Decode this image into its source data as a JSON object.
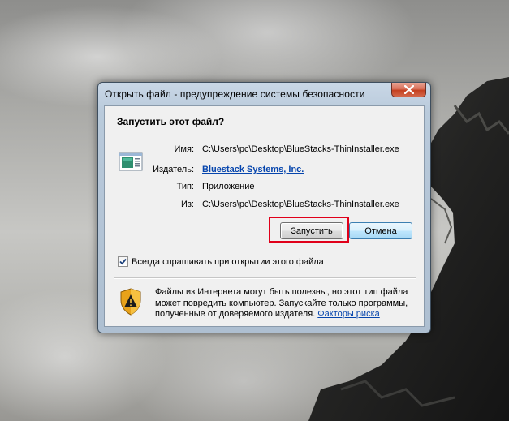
{
  "dialog": {
    "title": "Открыть файл - предупреждение системы безопасности",
    "heading": "Запустить этот файл?",
    "fields": {
      "name_label": "Имя:",
      "name_value": "C:\\Users\\pc\\Desktop\\BlueStacks-ThinInstaller.exe",
      "publisher_label": "Издатель:",
      "publisher_value": "Bluestack Systems, Inc.",
      "type_label": "Тип:",
      "type_value": "Приложение",
      "from_label": "Из:",
      "from_value": "C:\\Users\\pc\\Desktop\\BlueStacks-ThinInstaller.exe"
    },
    "buttons": {
      "run": "Запустить",
      "cancel": "Отмена"
    },
    "checkbox": {
      "label": "Всегда спрашивать при открытии этого файла",
      "checked": true
    },
    "warning": {
      "text": "Файлы из Интернета могут быть полезны, но этот тип файла может повредить компьютер. Запускайте только программы, полученные от доверяемого издателя.",
      "link": "Факторы риска"
    },
    "icons": {
      "close": "close-icon",
      "file": "application-file-icon",
      "shield": "security-shield-icon",
      "check": "checkmark-icon"
    },
    "colors": {
      "highlight": "#e0001a",
      "link": "#0645ad",
      "close_button": "#c4401f"
    }
  }
}
